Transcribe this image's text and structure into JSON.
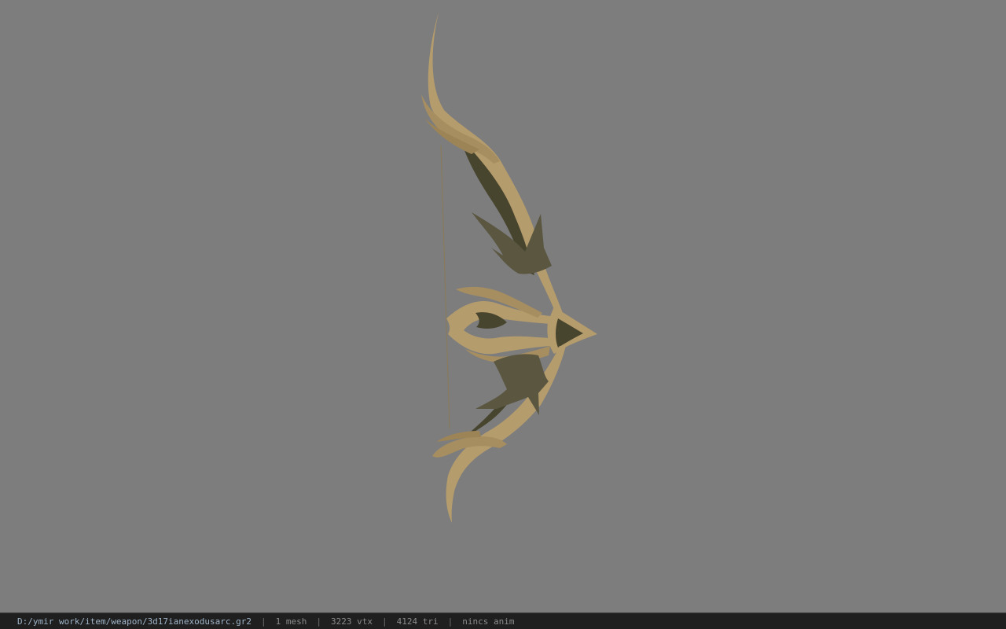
{
  "viewer": {
    "model_icon": "recurve-bow-icon",
    "colors": {
      "background": "#7d7d7d",
      "bow_light": "#b59c6c",
      "bow_dark": "#48452f",
      "statusbar_bg": "#1f1f1f",
      "path_text": "#9fb4c8",
      "stat_text": "#8c8c8c"
    }
  },
  "statusbar": {
    "path": "D:/ymir work/item/weapon/3d17ianexodusarc.gr2",
    "separator": "|",
    "mesh_count": "1 mesh",
    "vertex_count": "3223 vtx",
    "triangle_count": "4124 tri",
    "anim_status": "nincs anim"
  }
}
